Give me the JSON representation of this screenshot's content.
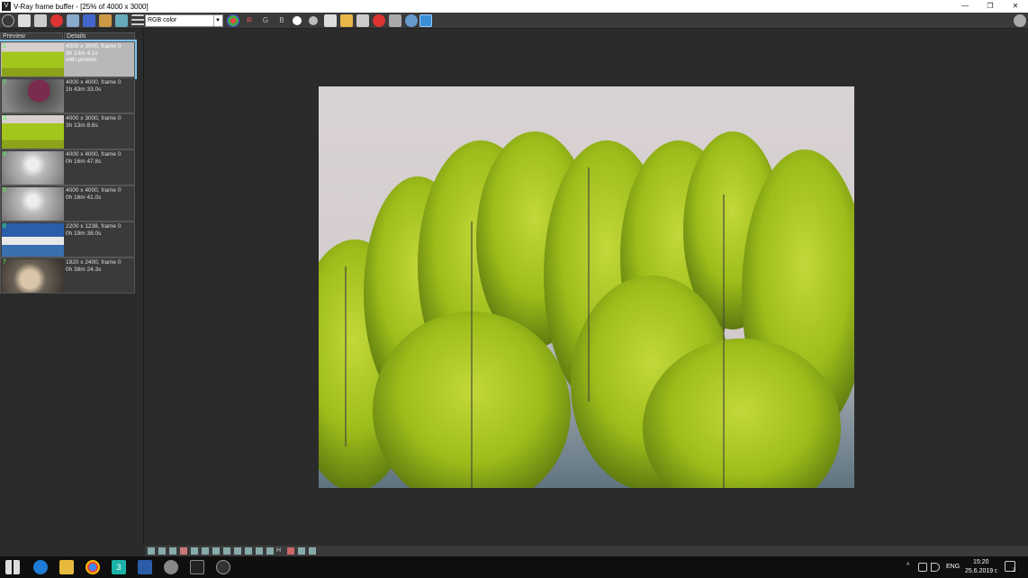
{
  "window": {
    "title": "V-Ray frame buffer - [25% of 4000 x 3000]",
    "minimize": "—",
    "restore": "❐",
    "close": "✕",
    "logo": "V"
  },
  "toolbar": {
    "channel_value": "RGB color",
    "r_label": "R",
    "g_label": "G",
    "b_label": "B"
  },
  "history": {
    "header_preview": "Preview",
    "header_details": "Details",
    "items": [
      {
        "idx": "1",
        "line1": "4000 x 3000, frame 0",
        "line2": "3h 13m 4.1s",
        "line3": "with proxies"
      },
      {
        "idx": "2",
        "line1": "4000 x 4000, frame 0",
        "line2": "1h 43m 33.0s",
        "line3": ""
      },
      {
        "idx": "3",
        "line1": "4000 x 3000, frame 0",
        "line2": "3h 13m 8.8s",
        "line3": ""
      },
      {
        "idx": "4",
        "line1": "4000 x 4000, frame 0",
        "line2": "0h 16m 47.8s",
        "line3": ""
      },
      {
        "idx": "5",
        "line1": "4000 x 4000, frame 0",
        "line2": "0h 16m 41.0s",
        "line3": ""
      },
      {
        "idx": "6",
        "line1": "2200 x 1238, frame 0",
        "line2": "0h 19m 38.0s",
        "line3": ""
      },
      {
        "idx": "7",
        "line1": "1920 x 2400, frame 0",
        "line2": "0h 38m 24.3s",
        "line3": ""
      }
    ]
  },
  "bottom_toolbar": {
    "h_label": "H"
  },
  "taskbar": {
    "language": "ENG",
    "time": "15:20",
    "date": "25.6.2019 г.",
    "notifications": "2",
    "app_label": "3"
  },
  "colors": {
    "accent": "#7fc3ee",
    "foliage": "#9fc21a",
    "sky": "#d8d0d0"
  }
}
